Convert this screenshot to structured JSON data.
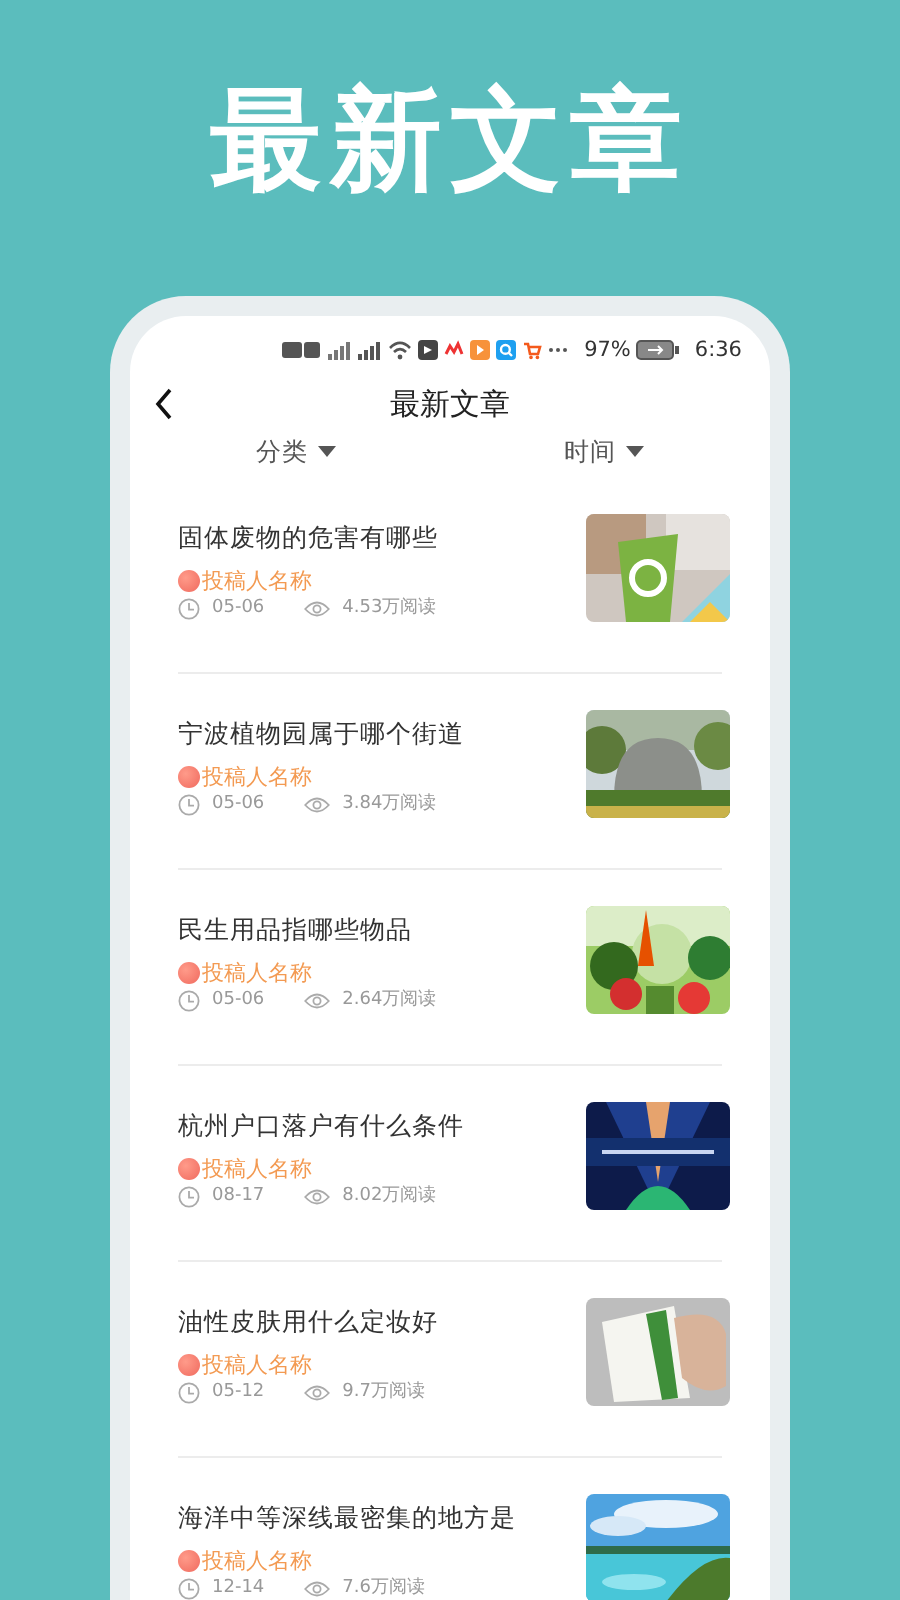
{
  "promo_title": "最新文章",
  "status_bar": {
    "battery": "97%",
    "time": "6:36"
  },
  "header": {
    "title": "最新文章"
  },
  "filters": [
    {
      "label": "分类"
    },
    {
      "label": "时间"
    }
  ],
  "articles": [
    {
      "title": "固体废物的危害有哪些",
      "author": "投稿人名称",
      "date": "05-06",
      "reads": "4.53万阅读"
    },
    {
      "title": "宁波植物园属于哪个街道",
      "author": "投稿人名称",
      "date": "05-06",
      "reads": "3.84万阅读"
    },
    {
      "title": "民生用品指哪些物品",
      "author": "投稿人名称",
      "date": "05-06",
      "reads": "2.64万阅读"
    },
    {
      "title": "杭州户口落户有什么条件",
      "author": "投稿人名称",
      "date": "08-17",
      "reads": "8.02万阅读"
    },
    {
      "title": "油性皮肤用什么定妆好",
      "author": "投稿人名称",
      "date": "05-12",
      "reads": "9.7万阅读"
    },
    {
      "title": "海洋中等深线最密集的地方是",
      "author": "投稿人名称",
      "date": "12-14",
      "reads": "7.6万阅读"
    }
  ]
}
